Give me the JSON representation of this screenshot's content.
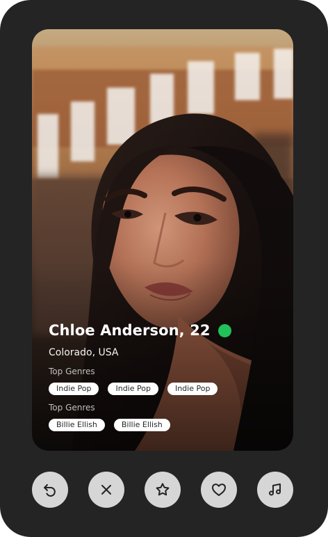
{
  "profile": {
    "name_age": "Chloe Anderson, 22",
    "location": "Colorado, USA",
    "online_status_color": "#21c25a",
    "top_genres_label": "Top Genres",
    "genres": [
      "Indie Pop",
      "Indie Pop",
      "Indie Pop"
    ],
    "top_artists_label": "Top Genres",
    "artists": [
      "Billie Ellish",
      "Billie Ellish"
    ]
  },
  "actions": [
    {
      "name": "rewind-button",
      "icon": "undo-icon"
    },
    {
      "name": "dislike-button",
      "icon": "close-icon"
    },
    {
      "name": "super-like-button",
      "icon": "star-icon"
    },
    {
      "name": "like-button",
      "icon": "heart-icon"
    },
    {
      "name": "music-button",
      "icon": "music-note-icon"
    }
  ],
  "colors": {
    "device_background": "#242424",
    "action_button": "#d6d6d6",
    "tag_background": "#ffffff",
    "online": "#21c25a"
  }
}
